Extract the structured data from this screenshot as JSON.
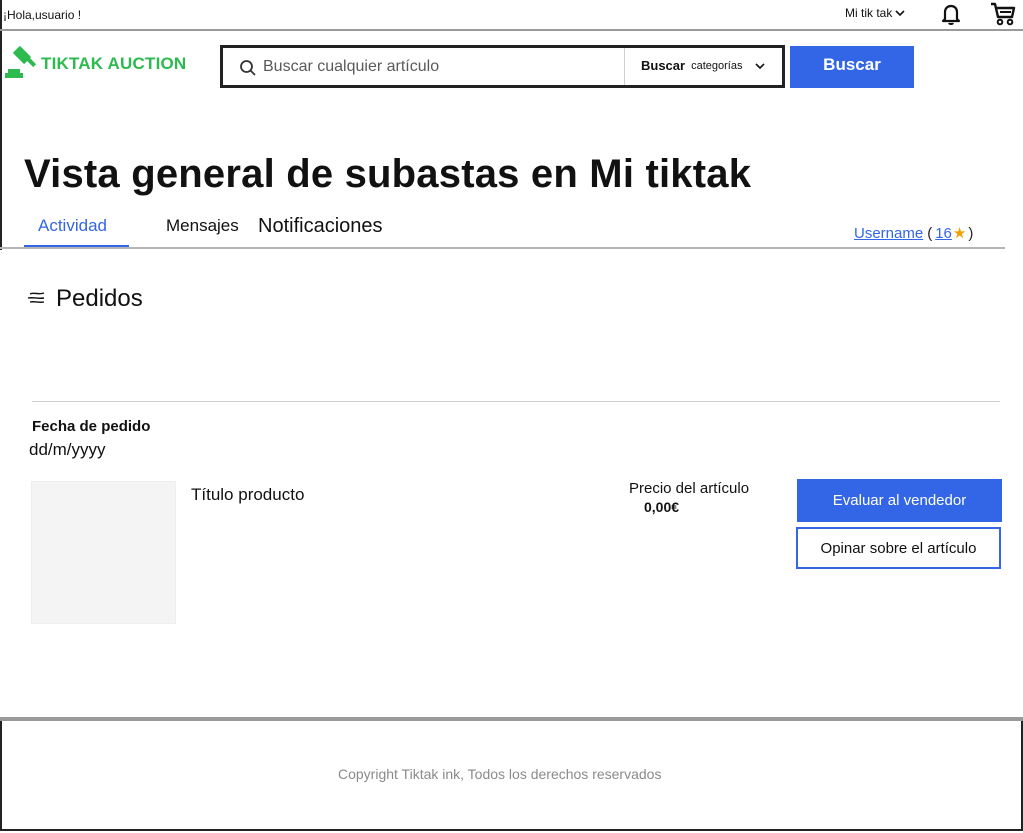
{
  "topbar": {
    "greeting": "¡Hola,usuario !",
    "mi_tiktak": "Mi tik tak",
    "icons": [
      "chevron-down-icon",
      "bell-icon",
      "cart-icon"
    ]
  },
  "header": {
    "logo_text": "TIKTAK AUCTION",
    "search_placeholder": "Buscar cualquier artículo",
    "category_bold": "Buscar",
    "category_small": "categorías",
    "search_button": "Buscar"
  },
  "page": {
    "title": "Vista general de subastas en Mi tiktak"
  },
  "tabs": [
    {
      "label": "Actividad",
      "active": true
    },
    {
      "label": "Mensajes",
      "active": false
    },
    {
      "label": "Notificaciones",
      "active": false
    }
  ],
  "user": {
    "username": "Username",
    "open_paren": "(",
    "rating": "16",
    "close_paren": ")"
  },
  "orders": {
    "title": "Pedidos",
    "date_label": "Fecha de pedido",
    "date_value": "dd/m/yyyy",
    "product_title": "Título producto",
    "price_label": "Precio del artículo",
    "price_value": "0,00€",
    "rate_seller": "Evaluar al vendedor",
    "review_item": "Opinar sobre el artículo"
  },
  "footer": {
    "copyright": "Copyright Tiktak ink, Todos los derechos reservados"
  },
  "colors": {
    "accent": "#3366e6",
    "brand": "#2dba4e",
    "star": "#f0a000"
  }
}
